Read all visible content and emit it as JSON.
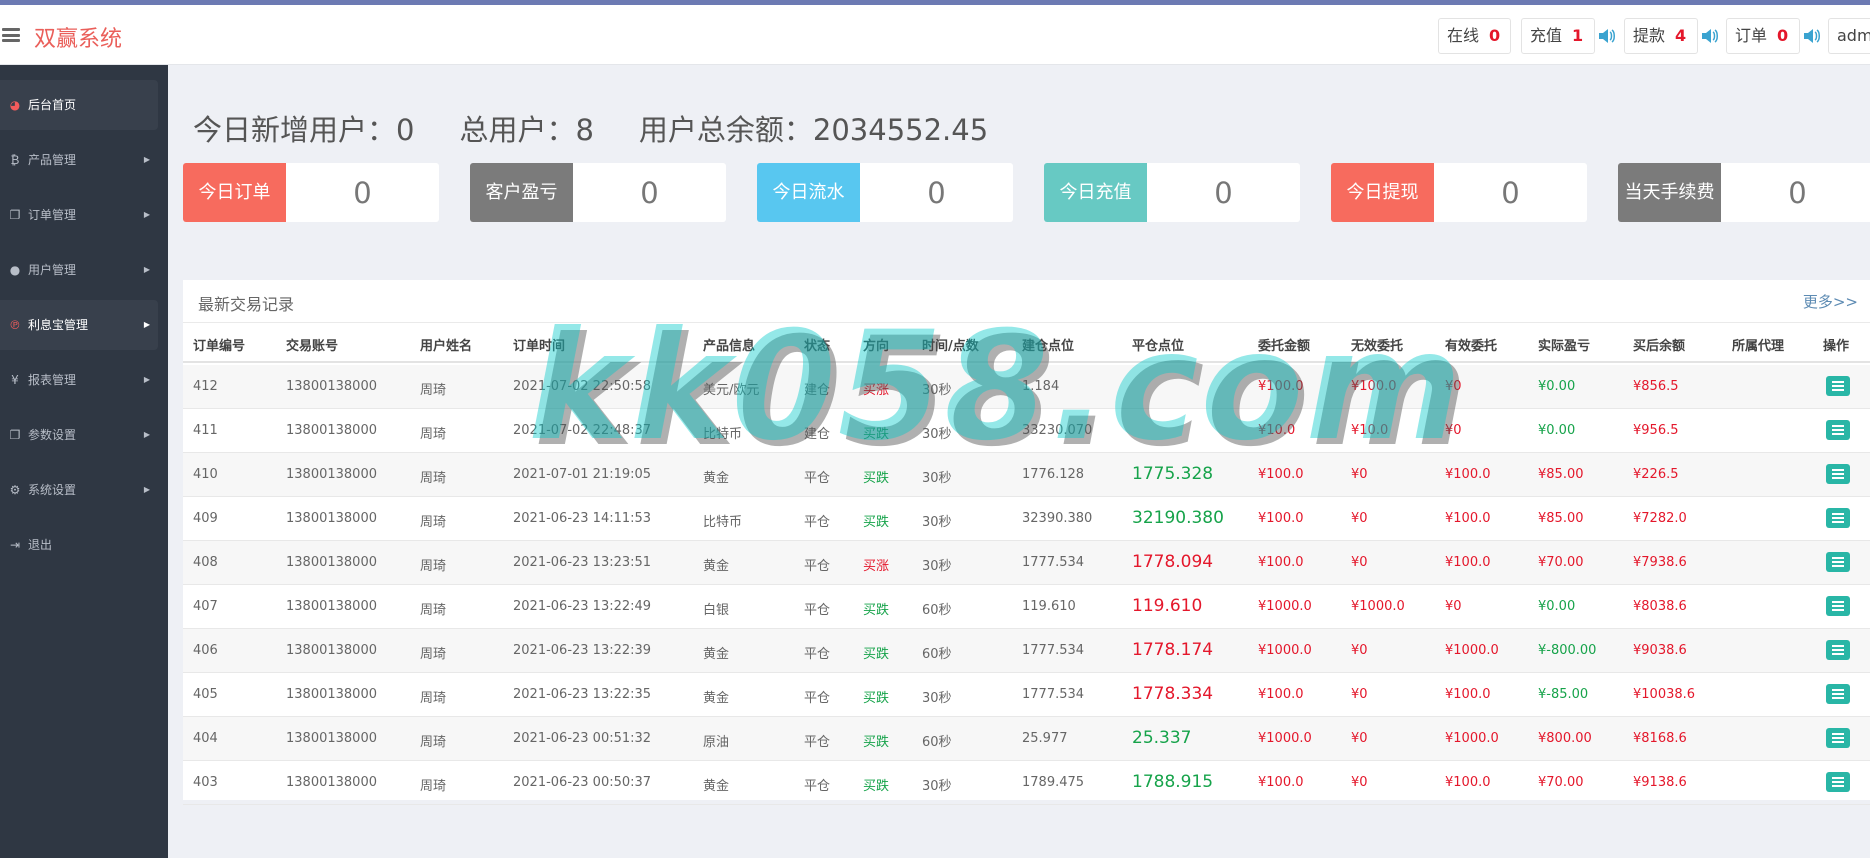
{
  "brand": "双赢系统",
  "topbar": {
    "online_label": "在线",
    "online_count": "0",
    "recharge_label": "充值",
    "recharge_count": "1",
    "withdraw_label": "提款",
    "withdraw_count": "4",
    "order_label": "订单",
    "order_count": "0",
    "user": "admin"
  },
  "sidebar": {
    "items": [
      {
        "label": "后台首页",
        "icon": "dashboard-icon"
      },
      {
        "label": "产品管理",
        "icon": "bitcoin-icon"
      },
      {
        "label": "订单管理",
        "icon": "copy-icon"
      },
      {
        "label": "用户管理",
        "icon": "user-icon"
      },
      {
        "label": "利息宝管理",
        "icon": "pinterest-icon"
      },
      {
        "label": "报表管理",
        "icon": "yen-icon"
      },
      {
        "label": "参数设置",
        "icon": "copy-icon"
      },
      {
        "label": "系统设置",
        "icon": "cogs-icon"
      },
      {
        "label": "退出",
        "icon": "sign-out-icon"
      }
    ]
  },
  "summary": {
    "new_users": "今日新增用户：0",
    "total_users": "总用户：8",
    "total_balance": "用户总余额：2034552.45"
  },
  "cards": [
    {
      "label": "今日订单",
      "value": "0",
      "color": "#f76b5e"
    },
    {
      "label": "客户盈亏",
      "value": "0",
      "color": "#7b7b7b"
    },
    {
      "label": "今日流水",
      "value": "0",
      "color": "#58c7f0"
    },
    {
      "label": "今日充值",
      "value": "0",
      "color": "#67c9c3"
    },
    {
      "label": "今日提现",
      "value": "0",
      "color": "#f76b5e"
    },
    {
      "label": "当天手续费",
      "value": "0",
      "color": "#7b7b7b"
    }
  ],
  "panel": {
    "title": "最新交易记录",
    "more": "更多>>"
  },
  "table": {
    "headers": [
      "订单编号",
      "交易账号",
      "用户姓名",
      "订单时间",
      "产品信息",
      "状态",
      "方向",
      "时间/点数",
      "建仓点位",
      "平仓点位",
      "委托金额",
      "无效委托",
      "有效委托",
      "实际盈亏",
      "买后余额",
      "所属代理",
      "操作"
    ],
    "rows": [
      {
        "id": "412",
        "account": "13800138000",
        "name": "周琦",
        "time": "2021-07-02 22:50:58",
        "product": "美元/欧元",
        "status": "建仓",
        "dir": "买涨",
        "dir_color": "red",
        "period": "30秒",
        "open": "1.184",
        "close": "",
        "close_color": "",
        "amount": "¥100.0",
        "invalid": "¥100.0",
        "valid": "¥0",
        "pl": "¥0.00",
        "pl_color": "green",
        "balance": "¥856.5",
        "agent": ""
      },
      {
        "id": "411",
        "account": "13800138000",
        "name": "周琦",
        "time": "2021-07-02 22:48:37",
        "product": "比特币",
        "status": "建仓",
        "dir": "买跌",
        "dir_color": "green",
        "period": "30秒",
        "open": "33230.070",
        "close": "",
        "close_color": "",
        "amount": "¥10.0",
        "invalid": "¥10.0",
        "valid": "¥0",
        "pl": "¥0.00",
        "pl_color": "green",
        "balance": "¥956.5",
        "agent": ""
      },
      {
        "id": "410",
        "account": "13800138000",
        "name": "周琦",
        "time": "2021-07-01 21:19:05",
        "product": "黄金",
        "status": "平仓",
        "dir": "买跌",
        "dir_color": "green",
        "period": "30秒",
        "open": "1776.128",
        "close": "1775.328",
        "close_color": "green",
        "amount": "¥100.0",
        "invalid": "¥0",
        "valid": "¥100.0",
        "pl": "¥85.00",
        "pl_color": "red",
        "balance": "¥226.5",
        "agent": ""
      },
      {
        "id": "409",
        "account": "13800138000",
        "name": "周琦",
        "time": "2021-06-23 14:11:53",
        "product": "比特币",
        "status": "平仓",
        "dir": "买跌",
        "dir_color": "green",
        "period": "30秒",
        "open": "32390.380",
        "close": "32190.380",
        "close_color": "green",
        "amount": "¥100.0",
        "invalid": "¥0",
        "valid": "¥100.0",
        "pl": "¥85.00",
        "pl_color": "red",
        "balance": "¥7282.0",
        "agent": ""
      },
      {
        "id": "408",
        "account": "13800138000",
        "name": "周琦",
        "time": "2021-06-23 13:23:51",
        "product": "黄金",
        "status": "平仓",
        "dir": "买涨",
        "dir_color": "red",
        "period": "30秒",
        "open": "1777.534",
        "close": "1778.094",
        "close_color": "red",
        "amount": "¥100.0",
        "invalid": "¥0",
        "valid": "¥100.0",
        "pl": "¥70.00",
        "pl_color": "red",
        "balance": "¥7938.6",
        "agent": ""
      },
      {
        "id": "407",
        "account": "13800138000",
        "name": "周琦",
        "time": "2021-06-23 13:22:49",
        "product": "白银",
        "status": "平仓",
        "dir": "买跌",
        "dir_color": "green",
        "period": "60秒",
        "open": "119.610",
        "close": "119.610",
        "close_color": "red",
        "amount": "¥1000.0",
        "invalid": "¥1000.0",
        "valid": "¥0",
        "pl": "¥0.00",
        "pl_color": "green",
        "balance": "¥8038.6",
        "agent": ""
      },
      {
        "id": "406",
        "account": "13800138000",
        "name": "周琦",
        "time": "2021-06-23 13:22:39",
        "product": "黄金",
        "status": "平仓",
        "dir": "买跌",
        "dir_color": "green",
        "period": "60秒",
        "open": "1777.534",
        "close": "1778.174",
        "close_color": "red",
        "amount": "¥1000.0",
        "invalid": "¥0",
        "valid": "¥1000.0",
        "pl": "¥-800.00",
        "pl_color": "green",
        "balance": "¥9038.6",
        "agent": ""
      },
      {
        "id": "405",
        "account": "13800138000",
        "name": "周琦",
        "time": "2021-06-23 13:22:35",
        "product": "黄金",
        "status": "平仓",
        "dir": "买跌",
        "dir_color": "green",
        "period": "30秒",
        "open": "1777.534",
        "close": "1778.334",
        "close_color": "red",
        "amount": "¥100.0",
        "invalid": "¥0",
        "valid": "¥100.0",
        "pl": "¥-85.00",
        "pl_color": "green",
        "balance": "¥10038.6",
        "agent": ""
      },
      {
        "id": "404",
        "account": "13800138000",
        "name": "周琦",
        "time": "2021-06-23 00:51:32",
        "product": "原油",
        "status": "平仓",
        "dir": "买跌",
        "dir_color": "green",
        "period": "60秒",
        "open": "25.977",
        "close": "25.337",
        "close_color": "green",
        "amount": "¥1000.0",
        "invalid": "¥0",
        "valid": "¥1000.0",
        "pl": "¥800.00",
        "pl_color": "red",
        "balance": "¥8168.6",
        "agent": ""
      },
      {
        "id": "403",
        "account": "13800138000",
        "name": "周琦",
        "time": "2021-06-23 00:50:37",
        "product": "黄金",
        "status": "平仓",
        "dir": "买跌",
        "dir_color": "green",
        "period": "30秒",
        "open": "1789.475",
        "close": "1788.915",
        "close_color": "green",
        "amount": "¥100.0",
        "invalid": "¥0",
        "valid": "¥100.0",
        "pl": "¥70.00",
        "pl_color": "red",
        "balance": "¥9138.6",
        "agent": ""
      }
    ]
  },
  "watermark": "kk058.com",
  "colors": {
    "red": "#e4172b",
    "green": "#16a34a",
    "sidebar": "#2f3743",
    "op_button": "#29b6a6"
  }
}
